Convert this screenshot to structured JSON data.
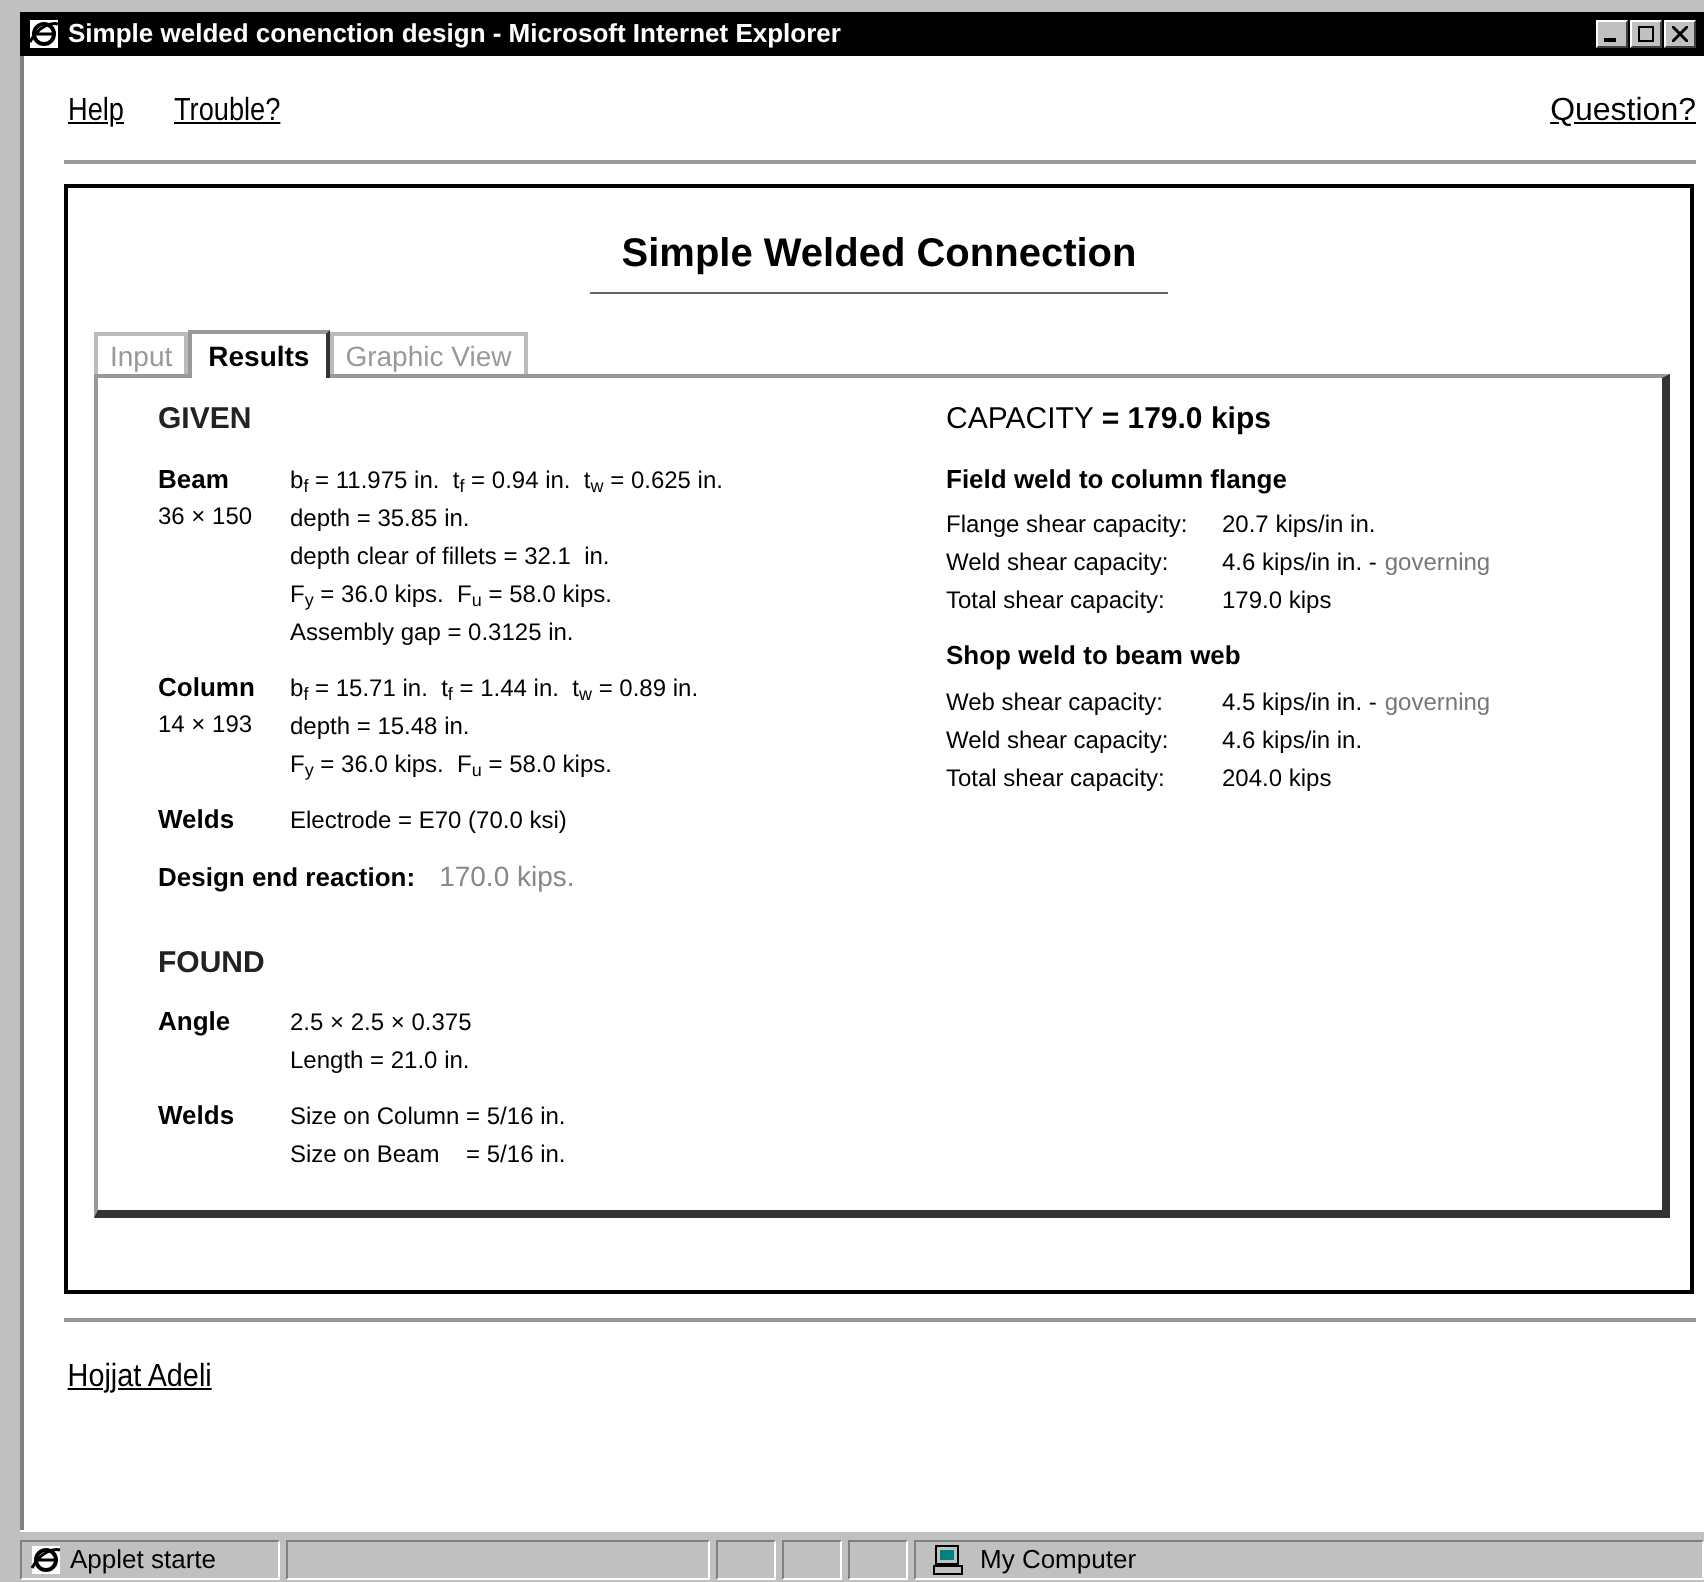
{
  "window": {
    "title": "Simple welded conenction design - Microsoft Internet Explorer"
  },
  "nav_links": [
    "Help",
    "Trouble?"
  ],
  "right_link": "Question?",
  "heading": "Simple Welded Connection",
  "tabs": [
    {
      "label": "Input",
      "selected": false
    },
    {
      "label": "Results",
      "selected": true
    },
    {
      "label": "Graphic View",
      "selected": false
    }
  ],
  "given": {
    "heading": "GIVEN",
    "groups": [
      {
        "label": "Beam",
        "sublabel": "36 × 150",
        "lines": [
          "b$_{f}$ = 11.975 in.  t$_{f}$ = 0.94 in.  t$_{w}$ = 0.625 in.",
          "depth = 35.85 in.",
          "depth clear of fillets = 32.1  in.",
          "F$_{y}$ = 36.0 kips.  F$_{u}$ = 58.0 kips.",
          "Assembly gap = 0.3125 in."
        ]
      },
      {
        "label": "Column",
        "sublabel": "14 × 193",
        "lines": [
          "b$_{f}$ = 15.71 in.  t$_{f}$ = 1.44 in.  t$_{w}$ = 0.89 in.",
          "depth = 15.48 in.",
          "F$_{y}$ = 36.0 kips.  F$_{u}$ = 58.0 kips."
        ]
      },
      {
        "label": "Welds",
        "lines": [
          "Electrode = E70 (70.0 ksi)"
        ]
      }
    ],
    "reaction": {
      "label": "Design end reaction:",
      "value": "170.0 kips."
    }
  },
  "found": {
    "heading": "FOUND",
    "groups": [
      {
        "label": "Angle",
        "lines": [
          "2.5 × 2.5 × 0.375",
          "Length = 21.0 in."
        ]
      },
      {
        "label": "Welds",
        "lines": [
          "Size on Column = 5/16 in.",
          "Size on Beam    = 5/16 in."
        ]
      }
    ]
  },
  "capacity": {
    "heading": "CAPACITY **= 179.0 kips**",
    "sections": [
      {
        "title": "Field weld to column flange",
        "rows": [
          {
            "label": "Flange shear capacity:",
            "value": "20.7 kips/in in."
          },
          {
            "label": "Weld shear capacity:",
            "value": "4.6 kips/in in. -",
            "note": "governing"
          },
          {
            "label": "Total shear capacity:",
            "value": "179.0 kips"
          }
        ]
      },
      {
        "title": "Shop weld to beam web",
        "rows": [
          {
            "label": "Web shear capacity:",
            "value": "4.5 kips/in in. -",
            "note": "governing"
          },
          {
            "label": "Weld shear capacity:",
            "value": "4.6 kips/in in."
          },
          {
            "label": "Total shear capacity:",
            "value": "204.0 kips"
          }
        ]
      }
    ]
  },
  "footer_link": "Hojjat Adeli",
  "status_bar": {
    "text": "Applet starte",
    "zone": "My Computer"
  }
}
